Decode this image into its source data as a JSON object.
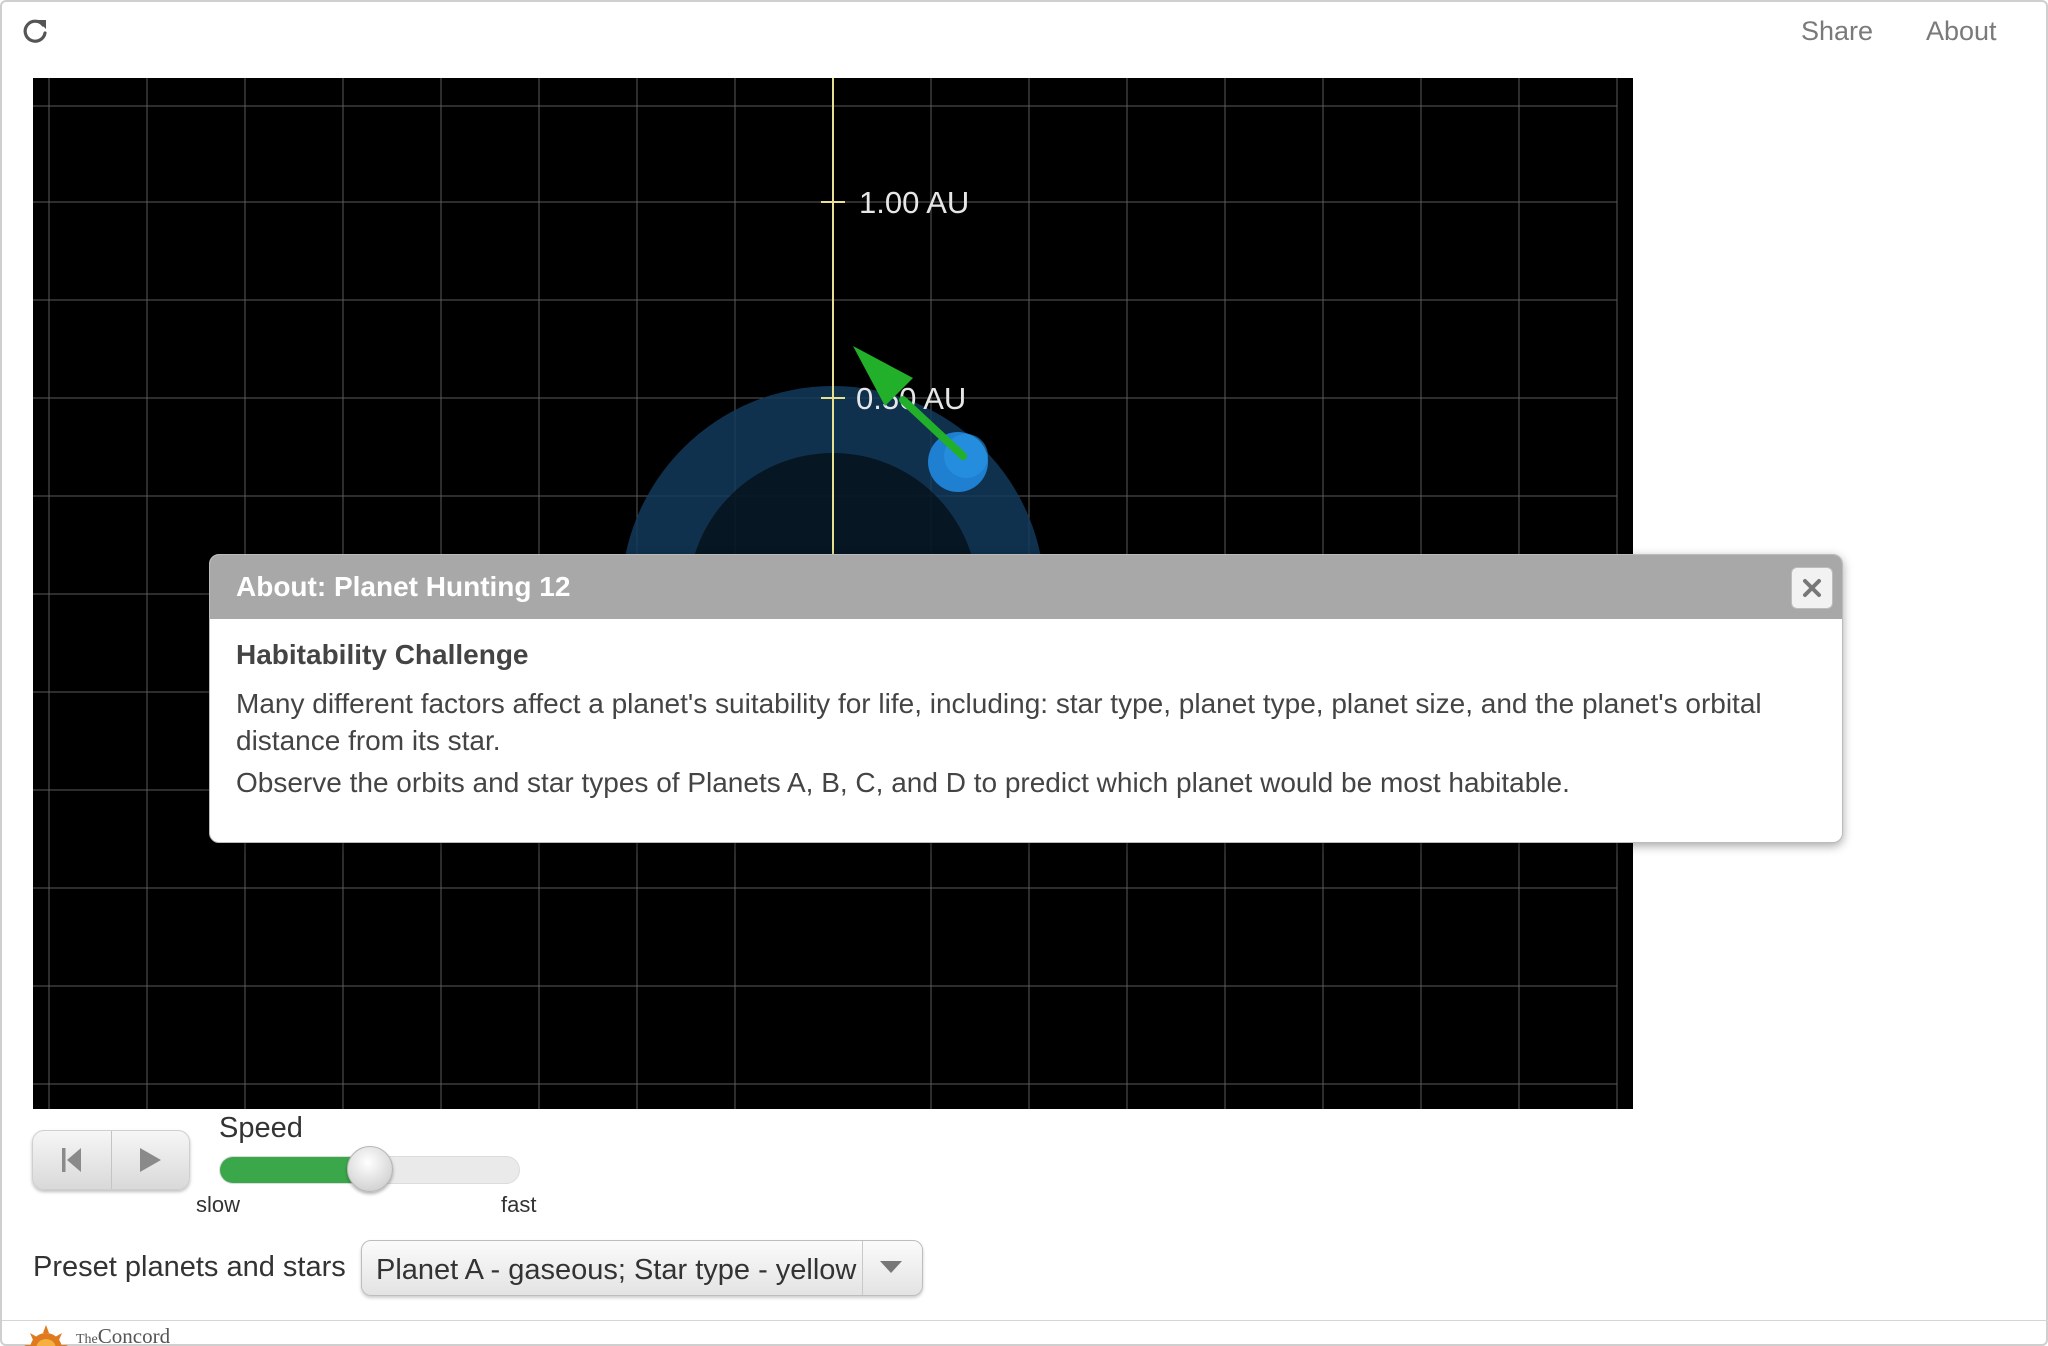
{
  "topbar": {
    "reload_icon": "reload-icon",
    "share_label": "Share",
    "about_label": "About"
  },
  "simulation": {
    "background": "#000000",
    "axis_labels": [
      "1.00 AU",
      "0.50 AU"
    ],
    "star_color": "#f5a623",
    "habitable_zone_color": "#1a4a6e",
    "planet_color": "#1f7fd0",
    "velocity_arrow_color": "#22b02a"
  },
  "controls": {
    "speed_label": "Speed",
    "speed_value": 0.5,
    "speed_min_label": "slow",
    "speed_max_label": "fast",
    "preset_label": "Preset planets and stars",
    "preset_selected": "Planet A - gaseous; Star type - yellow",
    "accent": "#3aa84a"
  },
  "dialog": {
    "title": "About: Planet Hunting 12",
    "heading": "Habitability Challenge",
    "paragraph_1": "Many different factors affect a planet's suitability for life, including: star type, planet type, planet size, and the planet's orbital distance from its star.",
    "paragraph_2": "Observe the orbits and star types of Planets A, B, C, and D to predict which planet would be most habitable.",
    "close_icon": "close-icon"
  },
  "footer": {
    "logo_text_small": "The",
    "logo_text": "Concord"
  }
}
